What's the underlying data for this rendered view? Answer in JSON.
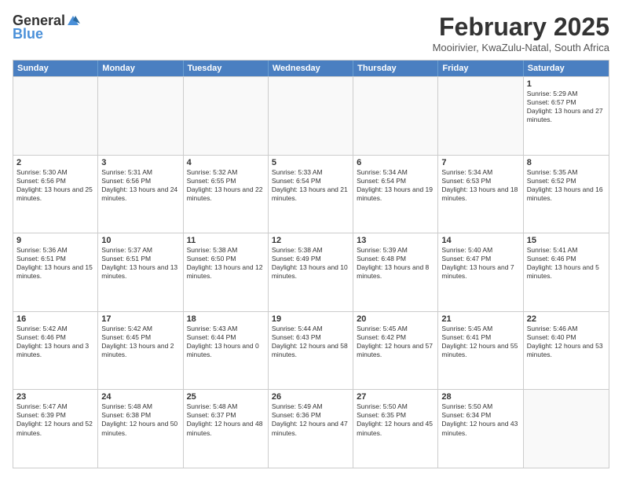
{
  "header": {
    "logo_general": "General",
    "logo_blue": "Blue",
    "month_title": "February 2025",
    "location": "Mooirivier, KwaZulu-Natal, South Africa"
  },
  "days_of_week": [
    "Sunday",
    "Monday",
    "Tuesday",
    "Wednesday",
    "Thursday",
    "Friday",
    "Saturday"
  ],
  "rows": [
    [
      {
        "day": "",
        "info": ""
      },
      {
        "day": "",
        "info": ""
      },
      {
        "day": "",
        "info": ""
      },
      {
        "day": "",
        "info": ""
      },
      {
        "day": "",
        "info": ""
      },
      {
        "day": "",
        "info": ""
      },
      {
        "day": "1",
        "info": "Sunrise: 5:29 AM\nSunset: 6:57 PM\nDaylight: 13 hours and 27 minutes."
      }
    ],
    [
      {
        "day": "2",
        "info": "Sunrise: 5:30 AM\nSunset: 6:56 PM\nDaylight: 13 hours and 25 minutes."
      },
      {
        "day": "3",
        "info": "Sunrise: 5:31 AM\nSunset: 6:56 PM\nDaylight: 13 hours and 24 minutes."
      },
      {
        "day": "4",
        "info": "Sunrise: 5:32 AM\nSunset: 6:55 PM\nDaylight: 13 hours and 22 minutes."
      },
      {
        "day": "5",
        "info": "Sunrise: 5:33 AM\nSunset: 6:54 PM\nDaylight: 13 hours and 21 minutes."
      },
      {
        "day": "6",
        "info": "Sunrise: 5:34 AM\nSunset: 6:54 PM\nDaylight: 13 hours and 19 minutes."
      },
      {
        "day": "7",
        "info": "Sunrise: 5:34 AM\nSunset: 6:53 PM\nDaylight: 13 hours and 18 minutes."
      },
      {
        "day": "8",
        "info": "Sunrise: 5:35 AM\nSunset: 6:52 PM\nDaylight: 13 hours and 16 minutes."
      }
    ],
    [
      {
        "day": "9",
        "info": "Sunrise: 5:36 AM\nSunset: 6:51 PM\nDaylight: 13 hours and 15 minutes."
      },
      {
        "day": "10",
        "info": "Sunrise: 5:37 AM\nSunset: 6:51 PM\nDaylight: 13 hours and 13 minutes."
      },
      {
        "day": "11",
        "info": "Sunrise: 5:38 AM\nSunset: 6:50 PM\nDaylight: 13 hours and 12 minutes."
      },
      {
        "day": "12",
        "info": "Sunrise: 5:38 AM\nSunset: 6:49 PM\nDaylight: 13 hours and 10 minutes."
      },
      {
        "day": "13",
        "info": "Sunrise: 5:39 AM\nSunset: 6:48 PM\nDaylight: 13 hours and 8 minutes."
      },
      {
        "day": "14",
        "info": "Sunrise: 5:40 AM\nSunset: 6:47 PM\nDaylight: 13 hours and 7 minutes."
      },
      {
        "day": "15",
        "info": "Sunrise: 5:41 AM\nSunset: 6:46 PM\nDaylight: 13 hours and 5 minutes."
      }
    ],
    [
      {
        "day": "16",
        "info": "Sunrise: 5:42 AM\nSunset: 6:46 PM\nDaylight: 13 hours and 3 minutes."
      },
      {
        "day": "17",
        "info": "Sunrise: 5:42 AM\nSunset: 6:45 PM\nDaylight: 13 hours and 2 minutes."
      },
      {
        "day": "18",
        "info": "Sunrise: 5:43 AM\nSunset: 6:44 PM\nDaylight: 13 hours and 0 minutes."
      },
      {
        "day": "19",
        "info": "Sunrise: 5:44 AM\nSunset: 6:43 PM\nDaylight: 12 hours and 58 minutes."
      },
      {
        "day": "20",
        "info": "Sunrise: 5:45 AM\nSunset: 6:42 PM\nDaylight: 12 hours and 57 minutes."
      },
      {
        "day": "21",
        "info": "Sunrise: 5:45 AM\nSunset: 6:41 PM\nDaylight: 12 hours and 55 minutes."
      },
      {
        "day": "22",
        "info": "Sunrise: 5:46 AM\nSunset: 6:40 PM\nDaylight: 12 hours and 53 minutes."
      }
    ],
    [
      {
        "day": "23",
        "info": "Sunrise: 5:47 AM\nSunset: 6:39 PM\nDaylight: 12 hours and 52 minutes."
      },
      {
        "day": "24",
        "info": "Sunrise: 5:48 AM\nSunset: 6:38 PM\nDaylight: 12 hours and 50 minutes."
      },
      {
        "day": "25",
        "info": "Sunrise: 5:48 AM\nSunset: 6:37 PM\nDaylight: 12 hours and 48 minutes."
      },
      {
        "day": "26",
        "info": "Sunrise: 5:49 AM\nSunset: 6:36 PM\nDaylight: 12 hours and 47 minutes."
      },
      {
        "day": "27",
        "info": "Sunrise: 5:50 AM\nSunset: 6:35 PM\nDaylight: 12 hours and 45 minutes."
      },
      {
        "day": "28",
        "info": "Sunrise: 5:50 AM\nSunset: 6:34 PM\nDaylight: 12 hours and 43 minutes."
      },
      {
        "day": "",
        "info": ""
      }
    ]
  ]
}
